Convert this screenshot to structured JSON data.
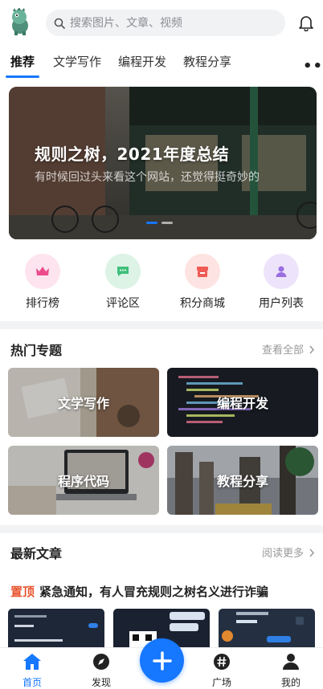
{
  "search": {
    "placeholder": "搜索图片、文章、视频"
  },
  "tabs": [
    {
      "label": "推荐",
      "active": true
    },
    {
      "label": "文学写作"
    },
    {
      "label": "编程开发"
    },
    {
      "label": "教程分享"
    }
  ],
  "banner": {
    "title": "规则之树，2021年度总结",
    "subtitle": "有时候回过头来看这个网站，还觉得挺奇妙的",
    "slides_total": 2,
    "active_slide": 1
  },
  "quick_links": [
    {
      "label": "排行榜",
      "icon": "crown-icon",
      "bg": "#fde4ee",
      "fg": "#ec4c8b"
    },
    {
      "label": "评论区",
      "icon": "comment-icon",
      "bg": "#dcf3e6",
      "fg": "#3fbf7a"
    },
    {
      "label": "积分商城",
      "icon": "store-icon",
      "bg": "#fde3e1",
      "fg": "#ef5b54"
    },
    {
      "label": "用户列表",
      "icon": "user-icon",
      "bg": "#ede4fb",
      "fg": "#9a6ee0"
    }
  ],
  "hot_topics": {
    "title": "热门专题",
    "more": "查看全部",
    "items": [
      {
        "label": "文学写作"
      },
      {
        "label": "编程开发"
      },
      {
        "label": "程序代码"
      },
      {
        "label": "教程分享"
      }
    ]
  },
  "latest": {
    "title": "最新文章",
    "more": "阅读更多",
    "pinned_tag": "置顶",
    "pinned_title": "紧急通知，有人冒充规则之树名义进行诈骗"
  },
  "bottom_nav": [
    {
      "label": "首页",
      "icon": "home-icon",
      "active": true
    },
    {
      "label": "发现",
      "icon": "compass-icon"
    },
    {
      "label": "广场",
      "icon": "hashtag-icon"
    },
    {
      "label": "我的",
      "icon": "profile-icon"
    }
  ],
  "colors": {
    "accent": "#1677ff",
    "pinned": "#e8542f"
  }
}
